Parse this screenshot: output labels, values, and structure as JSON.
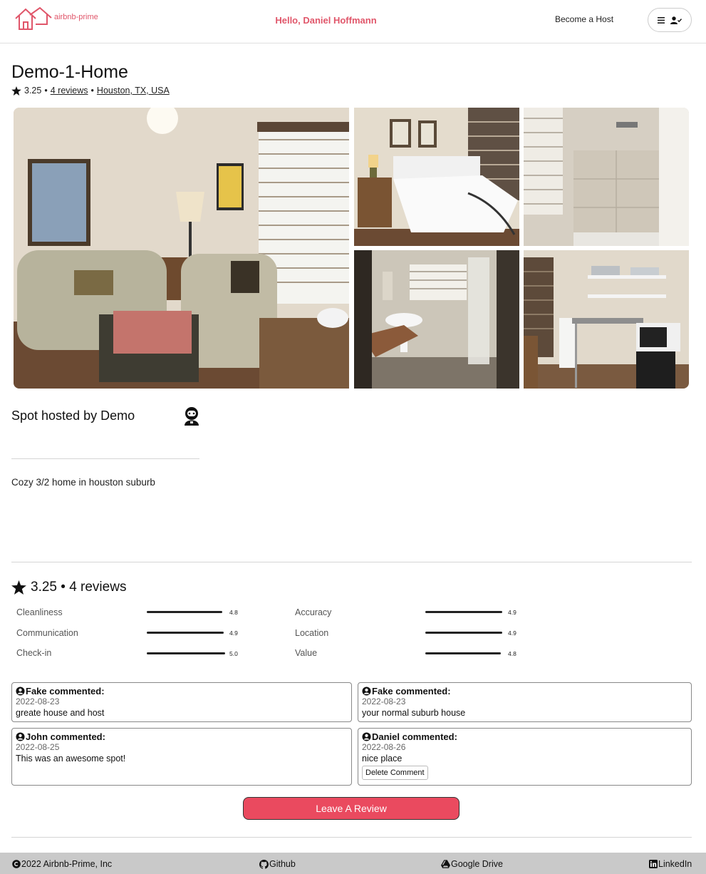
{
  "header": {
    "logo_text": "airbnb-prime",
    "greeting": "Hello, Daniel Hoffmann",
    "become_host": "Become a Host",
    "menu_icon": "hamburger-icon",
    "user_icon": "user-check-icon"
  },
  "listing": {
    "title": "Demo-1-Home",
    "rating": "3.25",
    "separator": "•",
    "reviews_link": "4 reviews",
    "location": "Houston, TX, USA"
  },
  "host": {
    "label": "Spot hosted by Demo",
    "avatar_icon": "astronaut-avatar-icon"
  },
  "description": "Cozy 3/2 home in houston suburb",
  "ratings": {
    "summary": "3.25 • 4 reviews",
    "categories": [
      {
        "label": "Cleanliness",
        "value": "4.8",
        "fill": 0.96
      },
      {
        "label": "Communication",
        "value": "4.9",
        "fill": 0.98
      },
      {
        "label": "Check-in",
        "value": "5.0",
        "fill": 1.0
      },
      {
        "label": "Accuracy",
        "value": "4.9",
        "fill": 0.98
      },
      {
        "label": "Location",
        "value": "4.9",
        "fill": 0.98
      },
      {
        "label": "Value",
        "value": "4.8",
        "fill": 0.96
      }
    ]
  },
  "reviews": [
    {
      "author": "Fake commented:",
      "date": "2022-08-23",
      "text": "greate house and host"
    },
    {
      "author": "Fake commented:",
      "date": "2022-08-23",
      "text": "your normal suburb house"
    },
    {
      "author": "John commented:",
      "date": "2022-08-25",
      "text": "This was an awesome spot!"
    },
    {
      "author": "Daniel commented:",
      "date": "2022-08-26",
      "text": "nice place",
      "action": "Delete Comment"
    }
  ],
  "leave_review": "Leave A Review",
  "footer": {
    "copyright": "2022 Airbnb-Prime, Inc",
    "github": "Github",
    "drive": "Google Drive",
    "linkedin": "LinkedIn"
  },
  "colors": {
    "brand": "#e0566a",
    "button": "#ea4a5f",
    "footer_bg": "#c9c9c9"
  }
}
